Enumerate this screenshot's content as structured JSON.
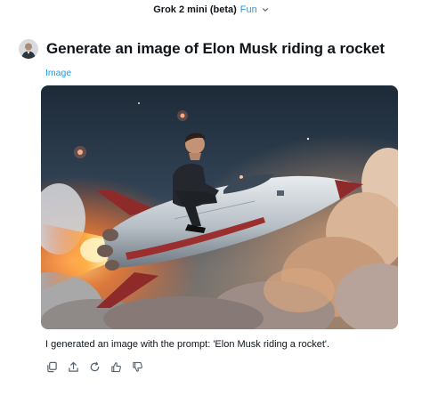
{
  "header": {
    "model_name": "Grok 2 mini (beta)",
    "mode_label": "Fun"
  },
  "prompt": {
    "text": "Generate an image of Elon Musk riding a rocket"
  },
  "attachment": {
    "label": "Image"
  },
  "response": {
    "text": "I generated an image with the prompt: 'Elon Musk riding a rocket'."
  },
  "actions": [
    {
      "icon": "copy-icon"
    },
    {
      "icon": "share-icon"
    },
    {
      "icon": "regenerate-icon"
    },
    {
      "icon": "thumbs-up-icon"
    },
    {
      "icon": "thumbs-down-icon"
    }
  ],
  "colors": {
    "accent": "#1d9bf0",
    "text": "#0f1419",
    "icon": "#536471"
  }
}
